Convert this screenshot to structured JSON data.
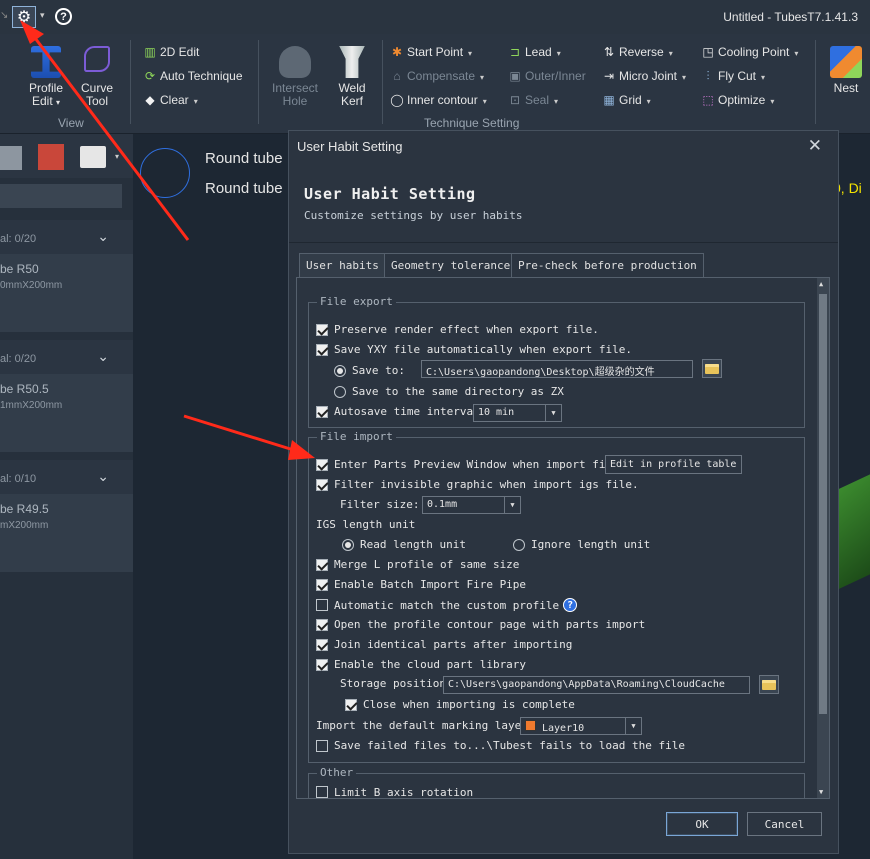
{
  "titlebar": {
    "title": "Untitled - TubesT7.1.41.3",
    "settings_icon": "gear-icon",
    "help_icon": "help-icon"
  },
  "ribbon": {
    "view_group": {
      "label": "View",
      "profile_edit": "Profile Edit",
      "curve_tool": "Curve Tool"
    },
    "edit_group": {
      "edit_2d": "2D Edit",
      "auto_technique": "Auto Technique",
      "clear": "Clear"
    },
    "technique_group": {
      "label": "Technique Setting",
      "intersect_hole": "Intersect Hole",
      "weld_kerf": "Weld Kerf",
      "start_point": "Start Point",
      "compensate": "Compensate",
      "inner_contour": "Inner contour",
      "lead": "Lead",
      "outer_inner": "Outer/Inner",
      "seal": "Seal",
      "reverse": "Reverse",
      "micro_joint": "Micro Joint",
      "grid": "Grid",
      "cooling_point": "Cooling Point",
      "fly_cut": "Fly Cut",
      "optimize": "Optimize"
    },
    "nest": "Nest"
  },
  "left_panel": {
    "sections": [
      {
        "header": "al: 0/20",
        "item_name": "be R50",
        "item_size": "0mmX200mm"
      },
      {
        "header": "al: 0/20",
        "item_name": "be R50.5",
        "item_size": "1mmX200mm"
      },
      {
        "header": "al: 0/10",
        "item_name": "be R49.5",
        "item_size": "mX200mm"
      }
    ]
  },
  "canvas": {
    "label1": "Round tube",
    "label2": "Round tube",
    "yellow_text": "0, Di"
  },
  "dialog": {
    "window_title": "User Habit Setting",
    "heading": "User Habit Setting",
    "subheading": "Customize settings by user habits",
    "tabs": [
      "User habits",
      "Geometry tolerance",
      "Pre-check before production"
    ],
    "file_export": {
      "legend": "File export",
      "preserve_render": "Preserve render effect when export file.",
      "save_yxy": "Save YXY file automatically  when export file.",
      "save_to_label": "Save to:",
      "save_to_path": "C:\\Users\\gaopandong\\Desktop\\超级杂的文件",
      "save_same_dir": "Save to the same directory as ZX",
      "autosave_label": "Autosave time interval:",
      "autosave_value": "10 min"
    },
    "file_import": {
      "legend": "File import",
      "enter_preview": "Enter Parts Preview Window when import file.",
      "edit_profile_table": "Edit in profile table",
      "filter_invisible": "Filter invisible graphic when import igs file.",
      "filter_size_label": "Filter size:",
      "filter_size_value": "0.1mm",
      "igs_length_unit": "IGS length unit",
      "read_length_unit": "Read length unit",
      "ignore_length_unit": "Ignore length unit",
      "merge_l_profile": "Merge L profile of same size",
      "batch_import_fire_pipe": "Enable Batch Import Fire Pipe",
      "auto_match_custom": "Automatic match the custom profile",
      "open_profile_contour": "Open the profile contour page with parts import",
      "join_identical": "Join identical parts after importing",
      "cloud_part_library": "Enable the cloud part library",
      "storage_position_label": "Storage position:",
      "storage_position_path": "C:\\Users\\gaopandong\\AppData\\Roaming\\CloudCache",
      "close_when_complete": "Close when importing is complete",
      "default_marking_layer_label": "Import the default marking layer:",
      "default_marking_layer_value": "Layer10",
      "save_failed_files": "Save failed files to...\\Tubest fails to load the file"
    },
    "other": {
      "legend": "Other",
      "limit_b_axis": "Limit B axis rotation"
    },
    "ok": "OK",
    "cancel": "Cancel"
  },
  "colors": {
    "annotation_arrow": "#ff2a1a",
    "layer_swatch": "#f07a2e",
    "accent_blue": "#2f6fe0"
  }
}
